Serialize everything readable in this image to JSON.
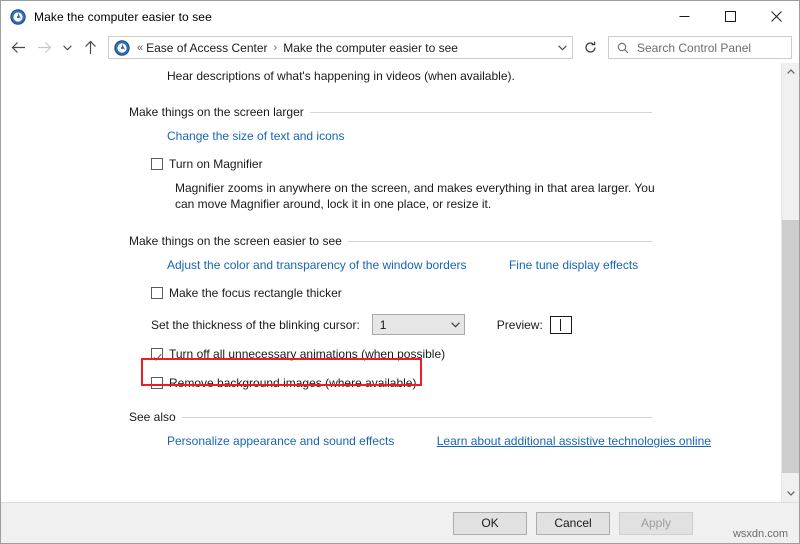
{
  "window": {
    "title": "Make the computer easier to see",
    "icon": "ease-of-access-icon",
    "minimize_label": "Minimize",
    "maximize_label": "Maximize",
    "close_label": "Close"
  },
  "addressbar": {
    "back_label": "Back",
    "forward_label": "Forward",
    "recent_label": "Recent locations",
    "up_label": "Up",
    "breadcrumb": {
      "root_chevrons": "«",
      "items": [
        "Ease of Access Center",
        "Make the computer easier to see"
      ],
      "separator": "›"
    },
    "dropdown_label": "Previous locations",
    "refresh_label": "Refresh"
  },
  "search": {
    "placeholder": "Search Control Panel",
    "icon": "search-icon"
  },
  "main": {
    "audio_description_text": "Hear descriptions of what's happening in videos (when available).",
    "groups": [
      {
        "title": "Make things on the screen larger",
        "links": [
          "Change the size of text and icons"
        ],
        "checkbox": {
          "label": "Turn on Magnifier",
          "checked": false
        },
        "description": "Magnifier zooms in anywhere on the screen, and makes everything in that area larger. You can move Magnifier around, lock it in one place, or resize it."
      },
      {
        "title": "Make things on the screen easier to see",
        "links": [
          "Adjust the color and transparency of the window borders",
          "Fine tune display effects"
        ],
        "focus_rectangle_checkbox": {
          "label": "Make the focus rectangle thicker",
          "checked": false
        },
        "cursor_thickness": {
          "label": "Set the thickness of the blinking cursor:",
          "value": "1",
          "preview_label": "Preview:"
        },
        "animations_checkbox": {
          "label": "Turn off all unnecessary animations (when possible)",
          "checked": true
        },
        "background_images_checkbox": {
          "label": "Remove background images (where available)",
          "checked": false,
          "highlighted": true,
          "highlight_color": "#ee1c25"
        }
      },
      {
        "title": "See also",
        "links": [
          "Personalize appearance and sound effects",
          "Learn about additional assistive technologies online"
        ]
      }
    ]
  },
  "scrollbar": {
    "up_label": "Scroll up",
    "down_label": "Scroll down",
    "thumb_label": "Scroll thumb"
  },
  "footer": {
    "ok_label": "OK",
    "cancel_label": "Cancel",
    "apply_label": "Apply",
    "apply_disabled": true,
    "watermark": "wsxdn.com"
  },
  "colors": {
    "link": "#1666b5",
    "accent_red": "#ee1c25",
    "chrome": "#f0f0f0"
  }
}
